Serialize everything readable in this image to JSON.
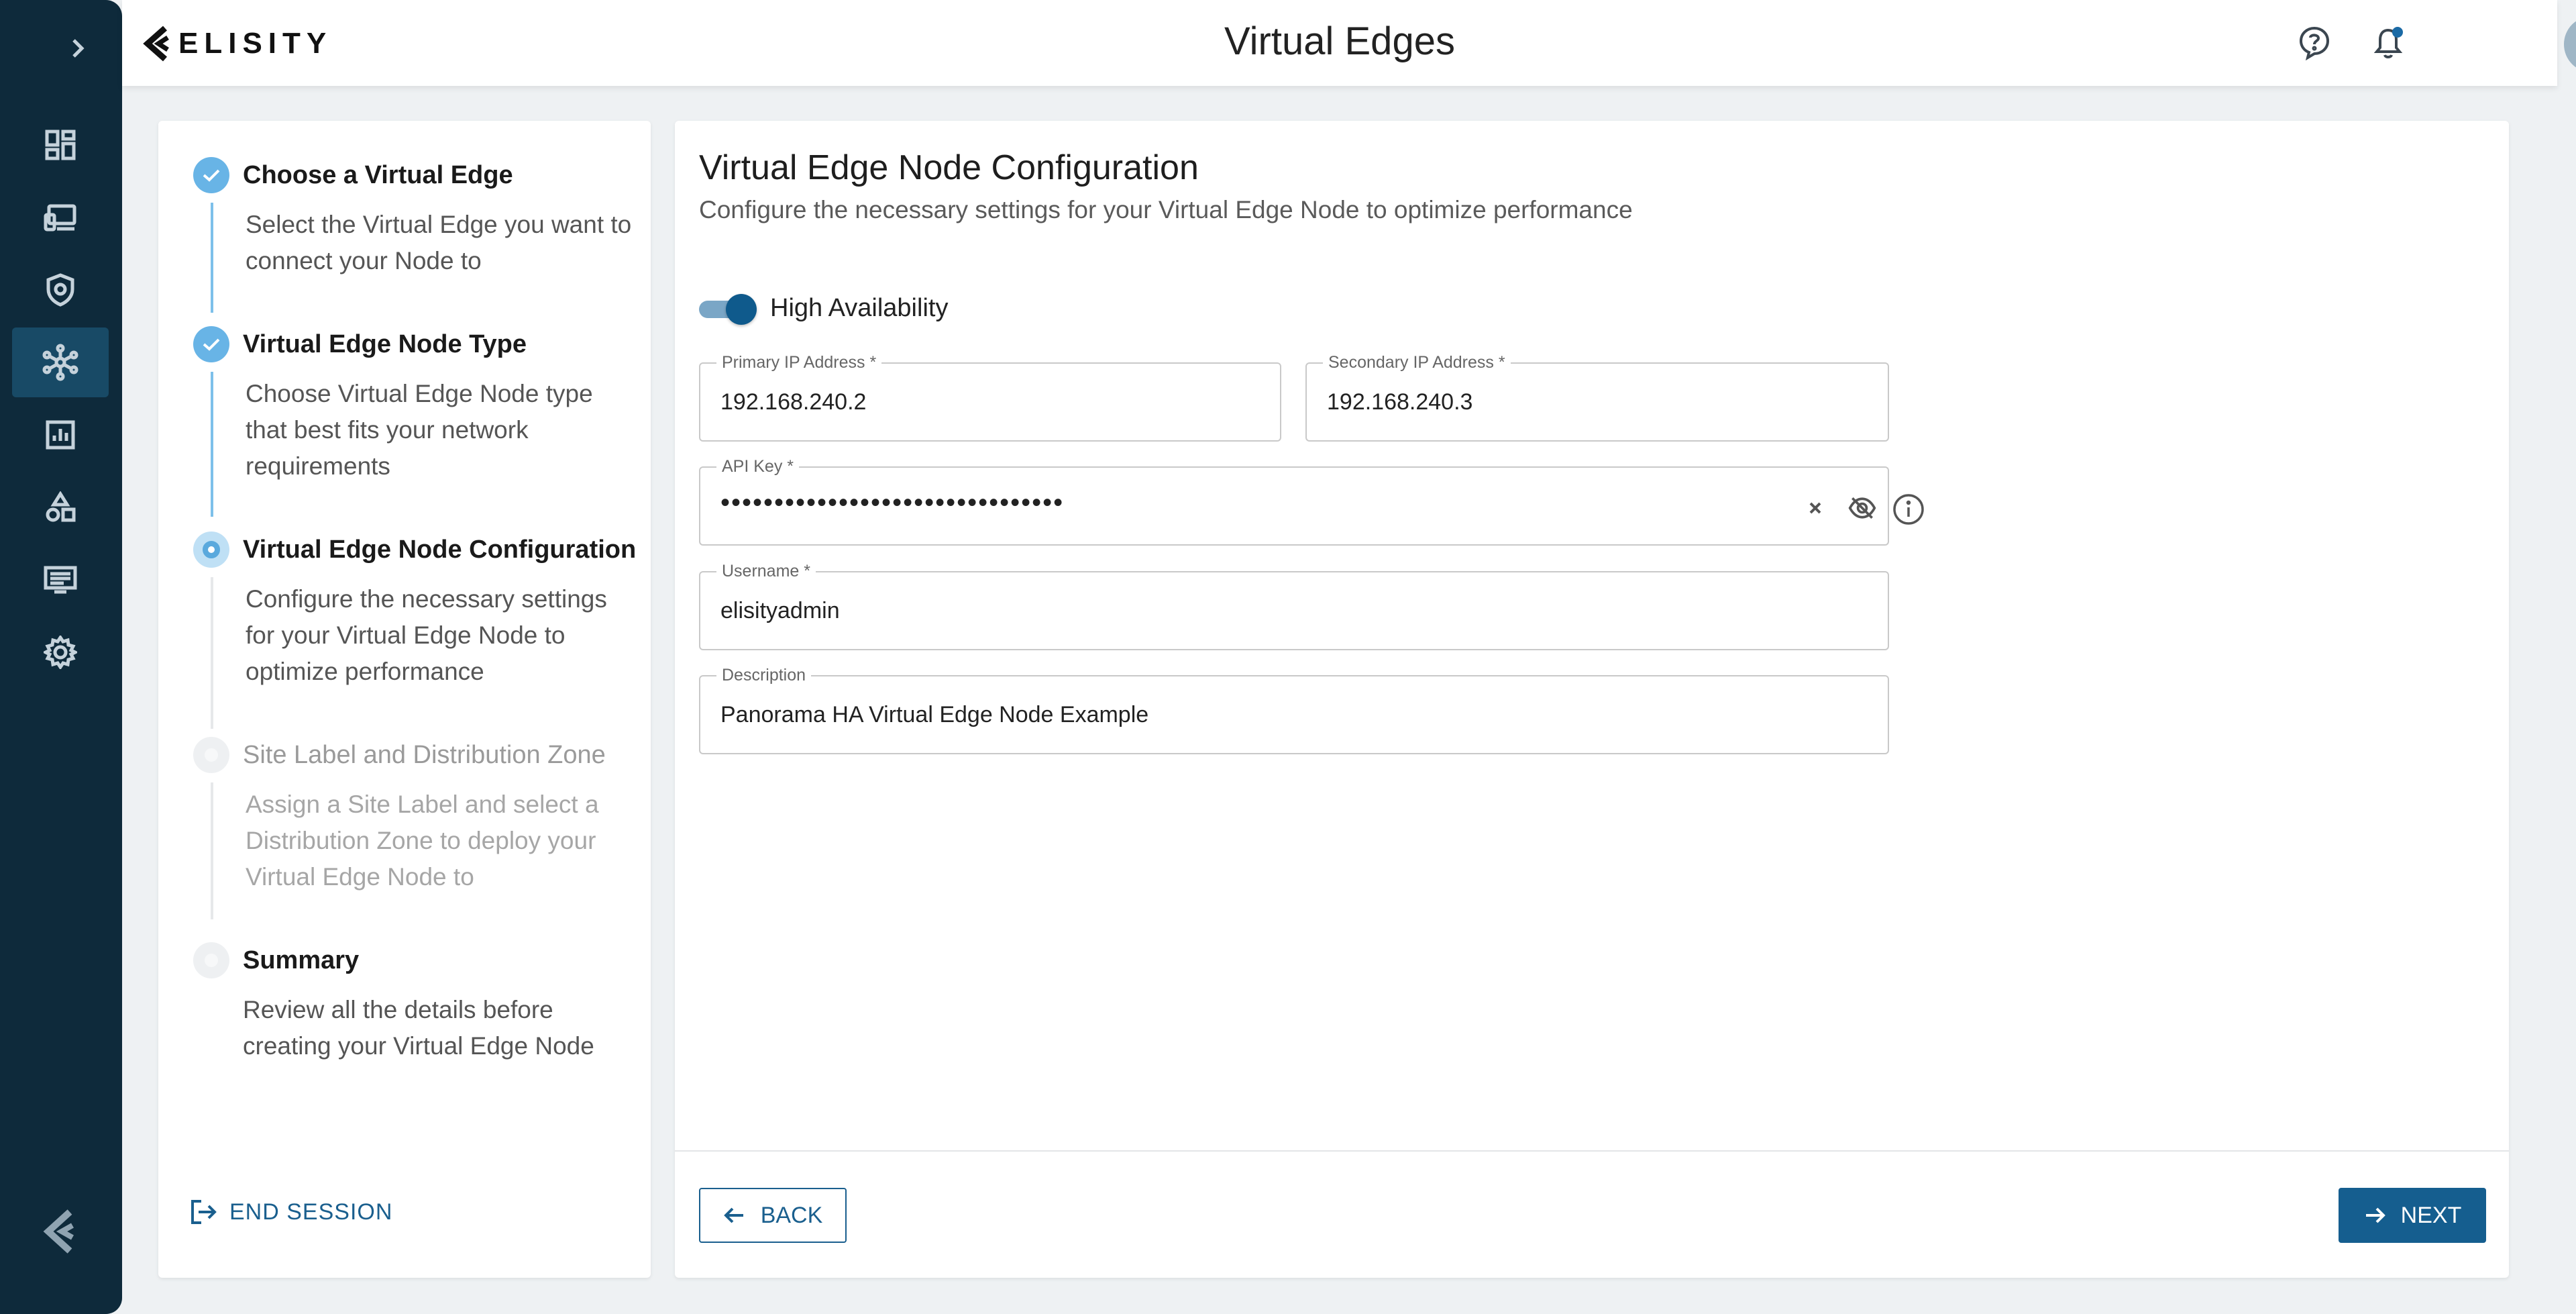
{
  "header": {
    "brand": "ELISITY",
    "title": "Virtual Edges"
  },
  "nav": {
    "items": [
      "dashboard-icon",
      "devices-icon",
      "policy-shield-icon",
      "network-topology-icon",
      "analytics-chart-icon",
      "shapes-icon",
      "logs-list-icon",
      "settings-gear-icon"
    ],
    "active_index": 3
  },
  "stepper": {
    "steps": [
      {
        "title": "Choose a Virtual Edge",
        "description": "Select the Virtual Edge you want to connect your Node to",
        "status": "done"
      },
      {
        "title": "Virtual Edge Node Type",
        "description": "Choose Virtual Edge Node type that best fits your network requirements",
        "status": "done"
      },
      {
        "title": "Virtual Edge Node Configuration",
        "description": "Configure the necessary settings for your Virtual Edge Node to optimize performance",
        "status": "current"
      },
      {
        "title": "Site Label and Distribution Zone",
        "description": "Assign a Site Label and select a Distribution Zone to deploy your Virtual Edge Node to",
        "status": "pending"
      },
      {
        "title": "Summary",
        "description": "Review all the details before creating your Virtual Edge Node",
        "status": "pending"
      }
    ],
    "end_session_label": "END SESSION"
  },
  "main": {
    "title": "Virtual Edge Node Configuration",
    "subtitle": "Configure the necessary settings for your Virtual Edge Node to optimize performance",
    "high_availability": {
      "label": "High Availability",
      "enabled": true
    },
    "fields": {
      "primary_ip": {
        "label": "Primary IP Address *",
        "value": "192.168.240.2"
      },
      "secondary_ip": {
        "label": "Secondary IP Address *",
        "value": "192.168.240.3"
      },
      "api_key": {
        "label": "API Key *",
        "value": "••••••••••••••••••••••••••••••••"
      },
      "username": {
        "label": "Username *",
        "value": "elisityadmin"
      },
      "description": {
        "label": "Description",
        "value": "Panorama HA Virtual Edge Node Example"
      }
    },
    "back_label": "BACK",
    "next_label": "NEXT"
  },
  "colors": {
    "nav_bg": "#0e2a3b",
    "accent": "#155e8f",
    "step_done": "#68b4e6"
  }
}
